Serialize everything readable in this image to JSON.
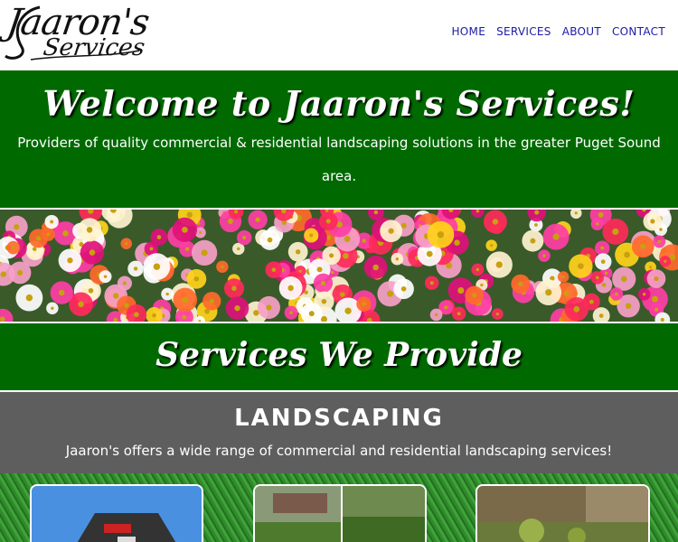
{
  "header": {
    "logo_line1": "Jaaron's",
    "logo_line2": "Services",
    "nav": [
      {
        "label": "HOME"
      },
      {
        "label": "SERVICES"
      },
      {
        "label": "ABOUT"
      },
      {
        "label": "CONTACT"
      }
    ]
  },
  "welcome": {
    "title": "Welcome to Jaaron's Services!",
    "subtitle": "Providers of quality commercial & residential landscaping solutions in the greater Puget Sound area."
  },
  "services": {
    "title": "Services We Provide"
  },
  "landscaping": {
    "title": "LANDSCAPING",
    "description": "Jaaron's offers a wide range of commercial and residential landscaping services!"
  },
  "colors": {
    "brand_green": "#006a00",
    "section_gray": "#5e5e5e",
    "nav_link": "#1a1aa6"
  }
}
